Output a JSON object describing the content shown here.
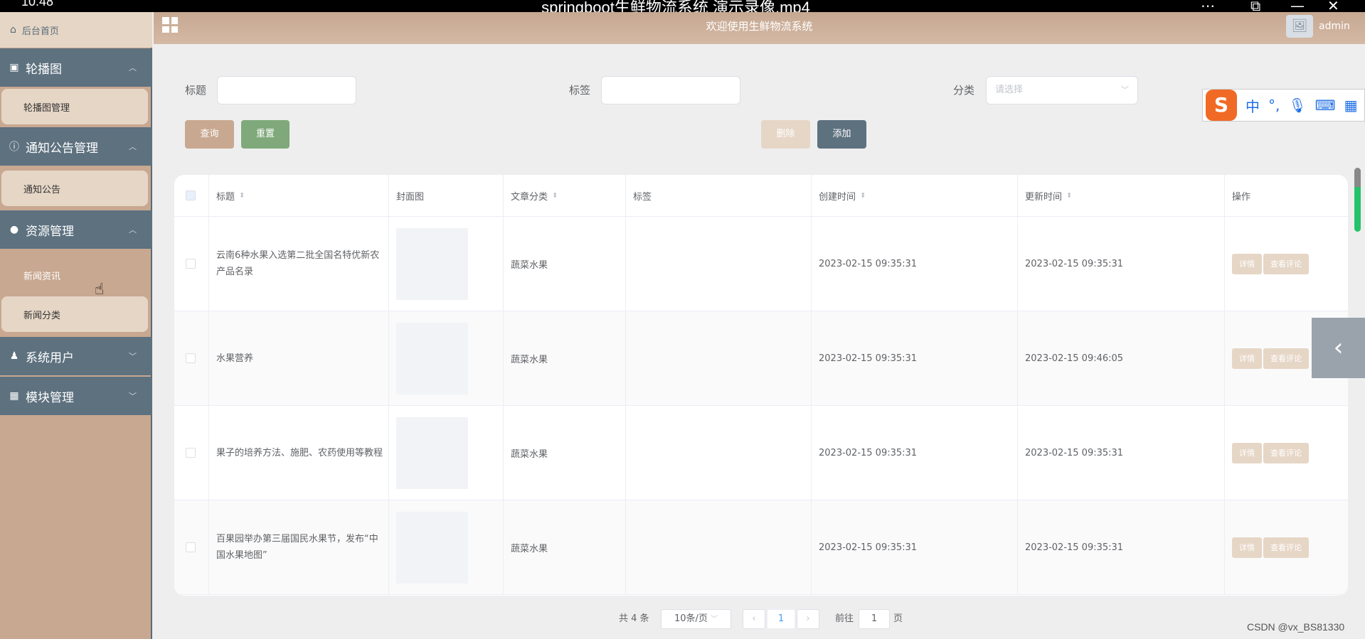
{
  "window": {
    "clock": "10:48",
    "video_title": "springboot生鲜物流系统 演示录像.mp4"
  },
  "sidebar": {
    "home": "后台首页",
    "groups": [
      {
        "label": "轮播图",
        "items": [
          "轮播图管理"
        ]
      },
      {
        "label": "通知公告管理",
        "items": [
          "通知公告"
        ]
      },
      {
        "label": "资源管理",
        "items": [
          "新闻资讯",
          "新闻分类"
        ],
        "active_item": "新闻资讯"
      },
      {
        "label": "系统用户",
        "items": []
      },
      {
        "label": "模块管理",
        "items": []
      }
    ]
  },
  "header": {
    "welcome": "欢迎使用生鲜物流系统",
    "user": "admin"
  },
  "search": {
    "title_label": "标题",
    "tag_label": "标签",
    "category_label": "分类",
    "category_placeholder": "请选择",
    "query_button": "查询",
    "reset_button": "重置",
    "delete_button": "删除",
    "add_button": "添加"
  },
  "table": {
    "columns": [
      "标题",
      "封面图",
      "文章分类",
      "标签",
      "创建时间",
      "更新时间",
      "操作"
    ],
    "rows": [
      {
        "title": "云南6种水果入选第二批全国名特优新农产品名录",
        "category": "蔬菜水果",
        "tag": "",
        "created": "2023-02-15 09:35:31",
        "updated": "2023-02-15 09:35:31"
      },
      {
        "title": "水果营养",
        "category": "蔬菜水果",
        "tag": "",
        "created": "2023-02-15 09:35:31",
        "updated": "2023-02-15 09:46:05"
      },
      {
        "title": "果子的培养方法、施肥、农药使用等教程",
        "category": "蔬菜水果",
        "tag": "",
        "created": "2023-02-15 09:35:31",
        "updated": "2023-02-15 09:35:31"
      },
      {
        "title": "百果园举办第三届国民水果节，发布“中国水果地图”",
        "category": "蔬菜水果",
        "tag": "",
        "created": "2023-02-15 09:35:31",
        "updated": "2023-02-15 09:35:31"
      }
    ],
    "detail_button": "详情",
    "comments_button": "查看评论"
  },
  "pagination": {
    "total": "共 4 条",
    "page_size": "10条/页",
    "current_page": "1",
    "goto_prefix": "前往",
    "goto_value": "1",
    "goto_suffix": "页"
  },
  "ime": {
    "lang": "中",
    "punct": "°,"
  },
  "watermark": "CSDN @vx_BS81330",
  "colors": {
    "sidebar_group": "#5d717f",
    "sidebar_bg": "#c8a890",
    "sidebar_item": "#e6d6c6",
    "query_button": "#c8a890",
    "reset_button": "#7fa97a",
    "add_button": "#5d717f",
    "delete_button": "#e6d6c6"
  }
}
